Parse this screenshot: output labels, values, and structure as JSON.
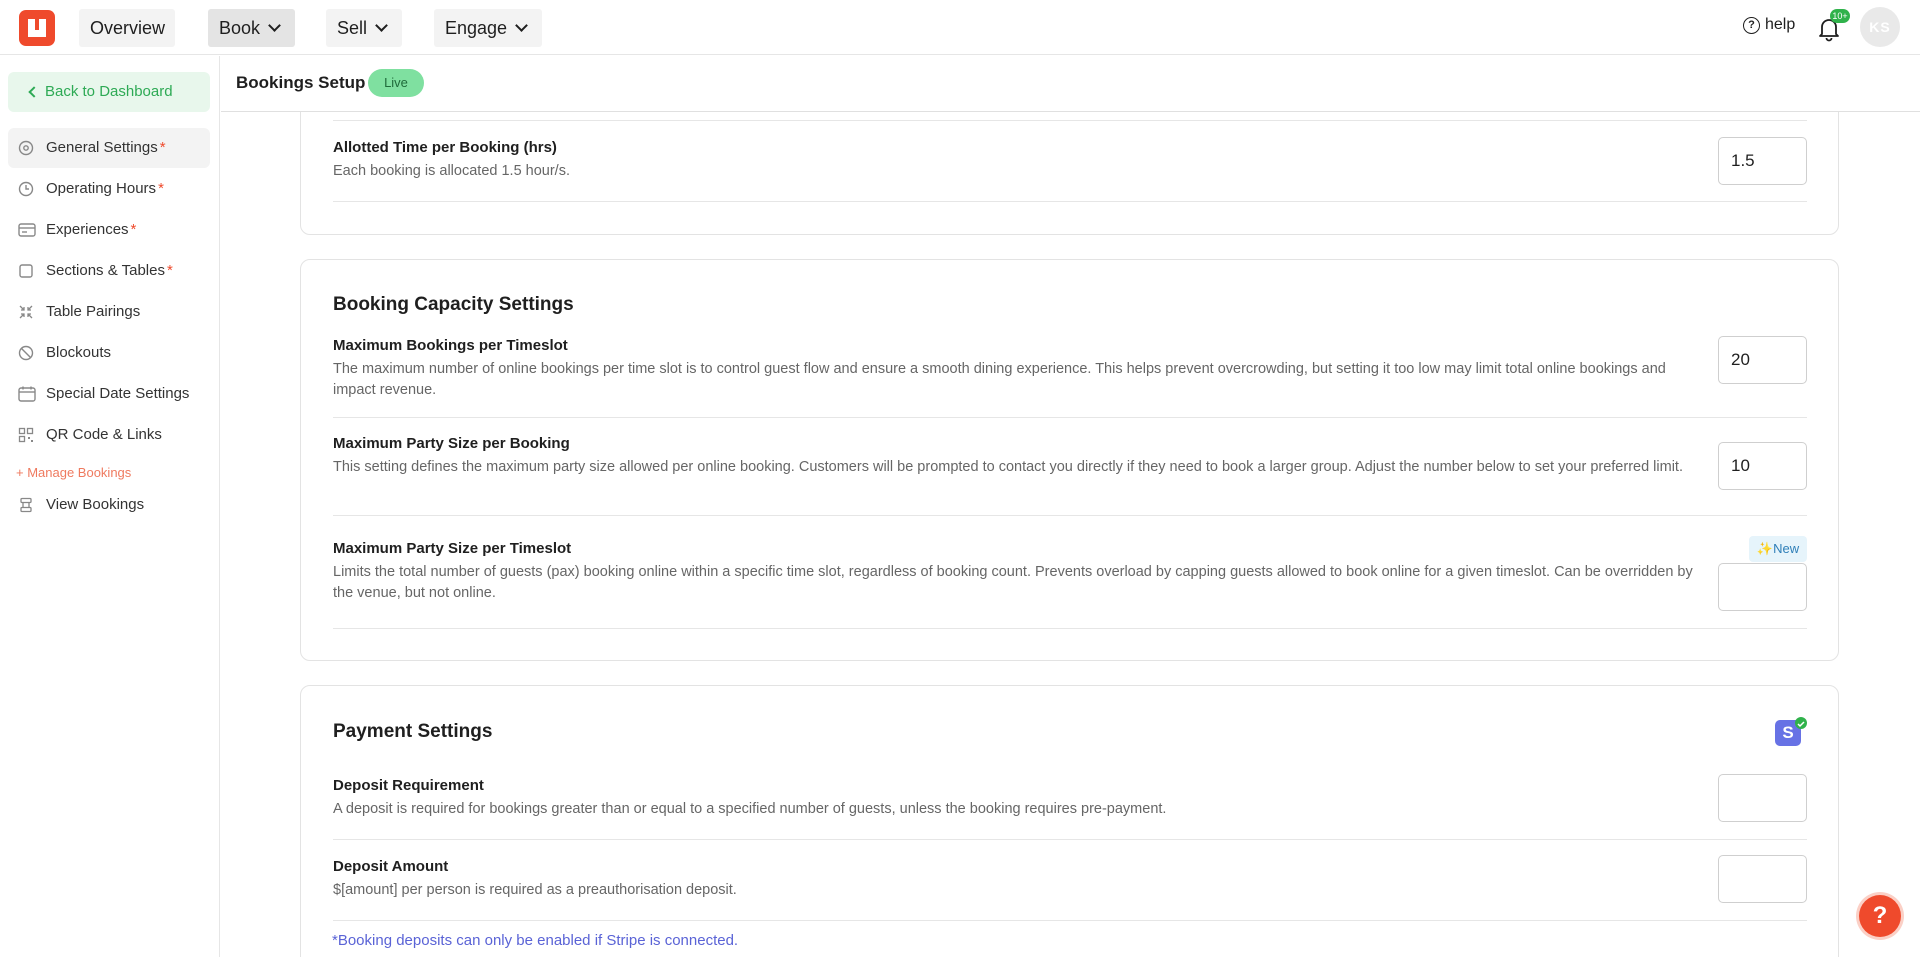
{
  "topbar": {
    "nav": {
      "overview": "Overview",
      "book": "Book",
      "sell": "Sell",
      "engage": "Engage"
    },
    "help_label": "help",
    "notification_badge": "10+",
    "avatar_initials": "KS"
  },
  "sidebar": {
    "back_label": "Back to Dashboard",
    "items": [
      {
        "label": "General Settings",
        "required": "*",
        "icon": "gear-icon"
      },
      {
        "label": "Operating Hours",
        "required": "*",
        "icon": "clock-icon"
      },
      {
        "label": "Experiences",
        "required": "*",
        "icon": "card-icon"
      },
      {
        "label": "Sections & Tables",
        "required": "*",
        "icon": "square-icon"
      },
      {
        "label": "Table Pairings",
        "icon": "shrink-arrows-icon"
      },
      {
        "label": "Blockouts",
        "icon": "block-icon"
      },
      {
        "label": "Special Date Settings",
        "icon": "calendar-icon"
      },
      {
        "label": "QR Code & Links",
        "icon": "qr-code-icon"
      }
    ],
    "section_label": "+ Manage Bookings",
    "view_bookings": {
      "label": "View Bookings",
      "icon": "bookings-stack-icon"
    }
  },
  "header": {
    "title": "Bookings Setup",
    "status": "Live"
  },
  "allotted_time": {
    "title": "Allotted Time per Booking (hrs)",
    "desc": "Each booking is allocated 1.5 hour/s.",
    "value": "1.5"
  },
  "capacity": {
    "title": "Booking Capacity Settings",
    "max_bookings": {
      "title": "Maximum Bookings per Timeslot",
      "desc": "The maximum number of online bookings per time slot is to control guest flow and ensure a smooth dining experience. This helps prevent overcrowding, but setting it too low may limit total online bookings and impact revenue.",
      "value": "20"
    },
    "max_party": {
      "title": "Maximum Party Size per Booking",
      "desc": "This setting defines the maximum party size allowed per online booking. Customers will be prompted to contact you directly if they need to book a larger group. Adjust the number below to set your preferred limit.",
      "value": "10"
    },
    "max_party_timeslot": {
      "title": "Maximum Party Size per Timeslot",
      "desc": "Limits the total number of guests (pax) booking online within a specific time slot, regardless of booking count. Prevents overload by capping guests allowed to book online for a given timeslot. Can be overridden by the venue, but not online.",
      "badge": "✨New",
      "value": ""
    }
  },
  "payment": {
    "title": "Payment Settings",
    "stripe_letter": "S",
    "deposit_requirement": {
      "title": "Deposit Requirement",
      "desc": "A deposit is required for bookings greater than or equal to a specified number of guests, unless the booking requires pre-payment.",
      "value": ""
    },
    "deposit_amount": {
      "title": "Deposit Amount",
      "desc": "$[amount] per person is required as a preauthorisation deposit.",
      "value": ""
    },
    "note": "*Booking deposits can only be enabled if Stripe is connected."
  },
  "help_fab": "?",
  "colors": {
    "brand": "#ef4a2c",
    "success": "#2eaa55",
    "stripe": "#6772e5",
    "link": "#5a63d6"
  }
}
